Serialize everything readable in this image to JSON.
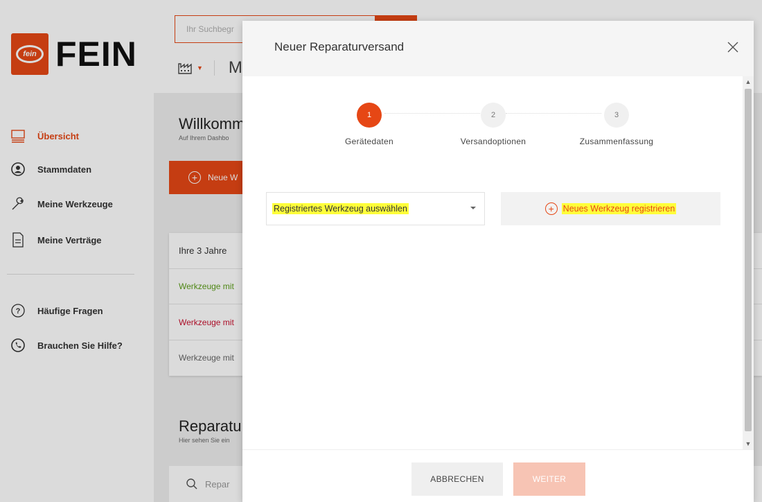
{
  "colors": {
    "brand": "#e64715",
    "highlight": "#ffff3a",
    "ok_text": "#5c9e1a",
    "warn_text": "#c8102e"
  },
  "header": {
    "logo_text": "FEIN",
    "logo_mark": "fein",
    "search_placeholder": "Ihr Suchbegr",
    "factory_icon": "factory-icon",
    "factory_partial": "M"
  },
  "sidebar": {
    "items": [
      {
        "label": "Übersicht",
        "icon": "overview-icon"
      },
      {
        "label": "Stammdaten",
        "icon": "user-icon"
      },
      {
        "label": "Meine Werkzeuge",
        "icon": "wrench-icon"
      },
      {
        "label": "Meine Verträge",
        "icon": "document-icon"
      },
      {
        "label": "Häufige Fragen",
        "icon": "question-icon"
      },
      {
        "label": "Brauchen Sie Hilfe?",
        "icon": "phone-icon"
      }
    ]
  },
  "main": {
    "welcome_title": "Willkomme",
    "welcome_sub": "Auf Ihrem Dashbo",
    "new_button": "Neue W",
    "card_title": "Ihre 3 Jahre",
    "card_rows": [
      "Werkzeuge mit",
      "Werkzeuge mit",
      "Werkzeuge mit"
    ],
    "repair_title": "Reparatura",
    "repair_sub": "Hier sehen Sie ein",
    "repair_search": "Repar"
  },
  "modal": {
    "title": "Neuer Reparaturversand",
    "steps": [
      {
        "number": "1",
        "label": "Gerätedaten"
      },
      {
        "number": "2",
        "label": "Versandoptionen"
      },
      {
        "number": "3",
        "label": "Zusammenfassung"
      }
    ],
    "active_step": 1,
    "tool_select_value": "Registriertes Werkzeug auswählen",
    "register_label": "Neues Werkzeug registrieren",
    "cancel_label": "ABBRECHEN",
    "next_label": "WEITER"
  }
}
